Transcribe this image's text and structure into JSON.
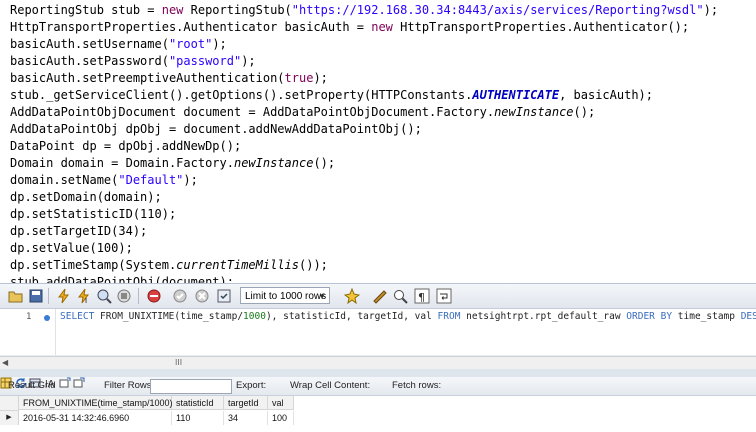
{
  "code": {
    "lines": [
      [
        "ReportingStub stub = ",
        "new",
        " ReportingStub(",
        "\"https://192.168.30.34:8443/axis/services/Reporting?wsdl\"",
        ");"
      ],
      [
        "HttpTransportProperties.Authenticator basicAuth = ",
        "new",
        " HttpTransportProperties.Authenticator();"
      ],
      [
        "basicAuth.setUsername(",
        "\"root\"",
        ");"
      ],
      [
        "basicAuth.setPassword(",
        "\"password\"",
        ");"
      ],
      [
        "basicAuth.setPreemptiveAuthentication(",
        "true",
        ");"
      ],
      [
        "stub._getServiceClient().getOptions().setProperty(HTTPConstants.",
        "AUTHENTICATE",
        ", basicAuth);"
      ],
      [
        "AddDataPointObjDocument document = AddDataPointObjDocument.Factory.",
        "newInstance",
        "();"
      ],
      [
        "AddDataPointObj dpObj = document.addNewAddDataPointObj();"
      ],
      [
        "DataPoint dp = dpObj.addNewDp();"
      ],
      [
        "Domain domain = Domain.Factory.",
        "newInstance",
        "();"
      ],
      [
        "domain.setName(",
        "\"Default\"",
        ");"
      ],
      [
        "dp.setDomain(domain);"
      ],
      [
        "dp.setStatisticID(110);"
      ],
      [
        "dp.setTargetID(34);"
      ],
      [
        "dp.setValue(100);"
      ],
      [
        "dp.setTimeStamp(System.",
        "currentTimeMillis",
        "());"
      ],
      [
        "stub.addDataPointObj(document);"
      ]
    ]
  },
  "toolbar": {
    "limit_label": "Limit to 1000 rows",
    "icons": [
      "open-file-icon",
      "save-icon",
      "execute-icon",
      "execute-selection-icon",
      "explain-icon",
      "stop-icon",
      "toggle-errors-icon",
      "commit-icon",
      "rollback-icon",
      "autocommit-icon",
      "beautify-icon",
      "find-icon",
      "invisible-chars-icon",
      "wrap-icon"
    ]
  },
  "editor": {
    "line_number": "1",
    "sql": {
      "select": "SELECT",
      "fn": " FROM_UNIXTIME",
      "args_open": "(time_stamp/",
      "num": "1000",
      "args_close": "), statisticId, targetId, val ",
      "from": "FROM",
      "table": " netsightrpt.rpt_default_raw ",
      "order": "ORDER BY",
      "col": " time_stamp ",
      "desc": "DESC"
    }
  },
  "scrollbar": {
    "thumb_label": "III"
  },
  "result_bar": {
    "result_grid": "Result Grid",
    "filter_rows": "Filter Rows:",
    "export": "Export:",
    "wrap": "Wrap Cell Content:",
    "fetch": "Fetch rows:"
  },
  "grid": {
    "columns": [
      "FROM_UNIXTIME(time_stamp/1000)",
      "statisticId",
      "targetId",
      "val"
    ],
    "rows": [
      [
        "2016-05-31 14:32:46.6960",
        "110",
        "34",
        "100"
      ]
    ],
    "row_marker": "▶"
  }
}
